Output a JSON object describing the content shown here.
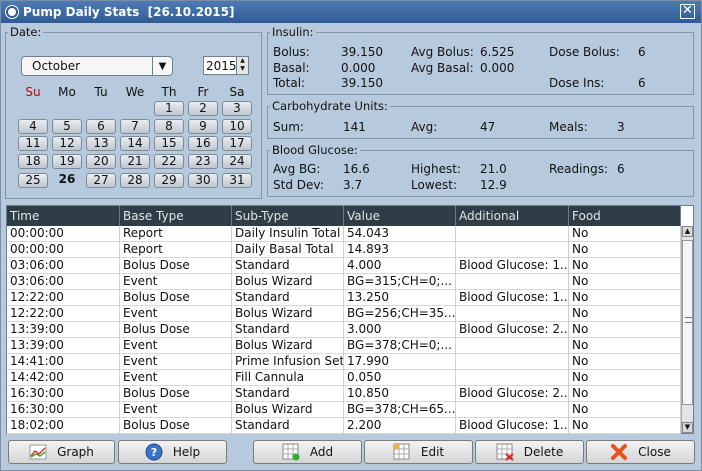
{
  "window": {
    "title": "Pump Daily Stats  [26.10.2015]",
    "close_glyph": "✕",
    "title_icon": "window-icon"
  },
  "date": {
    "legend": "Date:",
    "month": "October",
    "year": "2015",
    "weekdays": [
      "Su",
      "Mo",
      "Tu",
      "We",
      "Th",
      "Fr",
      "Sa"
    ],
    "days": [
      [
        "",
        "",
        "",
        "",
        "1",
        "2",
        "3"
      ],
      [
        "4",
        "5",
        "6",
        "7",
        "8",
        "9",
        "10"
      ],
      [
        "11",
        "12",
        "13",
        "14",
        "15",
        "16",
        "17"
      ],
      [
        "18",
        "19",
        "20",
        "21",
        "22",
        "23",
        "24"
      ],
      [
        "25",
        "26",
        "27",
        "28",
        "29",
        "30",
        "31"
      ]
    ],
    "selected_day": "26"
  },
  "insulin": {
    "legend": "Insulin:",
    "bolus_label": "Bolus:",
    "bolus": "39.150",
    "basal_label": "Basal:",
    "basal": "0.000",
    "total_label": "Total:",
    "total": "39.150",
    "avg_bolus_label": "Avg Bolus:",
    "avg_bolus": "6.525",
    "avg_basal_label": "Avg Basal:",
    "avg_basal": "0.000",
    "dose_bolus_label": "Dose Bolus:",
    "dose_bolus": "6",
    "dose_ins_label": "Dose Ins:",
    "dose_ins": "6"
  },
  "carbs": {
    "legend": "Carbohydrate Units:",
    "sum_label": "Sum:",
    "sum": "141",
    "avg_label": "Avg:",
    "avg": "47",
    "meals_label": "Meals:",
    "meals": "3"
  },
  "bg": {
    "legend": "Blood Glucose:",
    "avg_label": "Avg BG:",
    "avg": "16.6",
    "std_label": "Std Dev:",
    "std": "3.7",
    "highest_label": "Highest:",
    "highest": "21.0",
    "lowest_label": "Lowest:",
    "lowest": "12.9",
    "readings_label": "Readings:",
    "readings": "6"
  },
  "table": {
    "columns": [
      "Time",
      "Base Type",
      "Sub-Type",
      "Value",
      "Additional",
      "Food"
    ],
    "rows": [
      [
        "00:00:00",
        "Report",
        "Daily Insulin Total",
        "54.043",
        "",
        "No"
      ],
      [
        "00:00:00",
        "Report",
        "Daily Basal Total",
        "14.893",
        "",
        "No"
      ],
      [
        "03:06:00",
        "Bolus Dose",
        "Standard",
        "4.000",
        "Blood Glucose: 1...",
        "No"
      ],
      [
        "03:06:00",
        "Event",
        "Bolus Wizard",
        "BG=315;CH=0;...",
        "",
        "No"
      ],
      [
        "12:22:00",
        "Bolus Dose",
        "Standard",
        "13.250",
        "Blood Glucose: 1...",
        "No"
      ],
      [
        "12:22:00",
        "Event",
        "Bolus Wizard",
        "BG=256;CH=35...",
        "",
        "No"
      ],
      [
        "13:39:00",
        "Bolus Dose",
        "Standard",
        "3.000",
        "Blood Glucose: 2...",
        "No"
      ],
      [
        "13:39:00",
        "Event",
        "Bolus Wizard",
        "BG=378;CH=0;...",
        "",
        "No"
      ],
      [
        "14:41:00",
        "Event",
        "Prime Infusion Set",
        "17.990",
        "",
        "No"
      ],
      [
        "14:42:00",
        "Event",
        "Fill Cannula",
        "0.050",
        "",
        "No"
      ],
      [
        "16:30:00",
        "Bolus Dose",
        "Standard",
        "10.850",
        "Blood Glucose: 2...",
        "No"
      ],
      [
        "16:30:00",
        "Event",
        "Bolus Wizard",
        "BG=378;CH=65...",
        "",
        "No"
      ],
      [
        "18:02:00",
        "Bolus Dose",
        "Standard",
        "2.200",
        "Blood Glucose: 1...",
        "No"
      ]
    ]
  },
  "buttons": {
    "graph": "Graph",
    "help": "Help",
    "add": "Add",
    "edit": "Edit",
    "delete": "Delete",
    "close": "Close"
  }
}
